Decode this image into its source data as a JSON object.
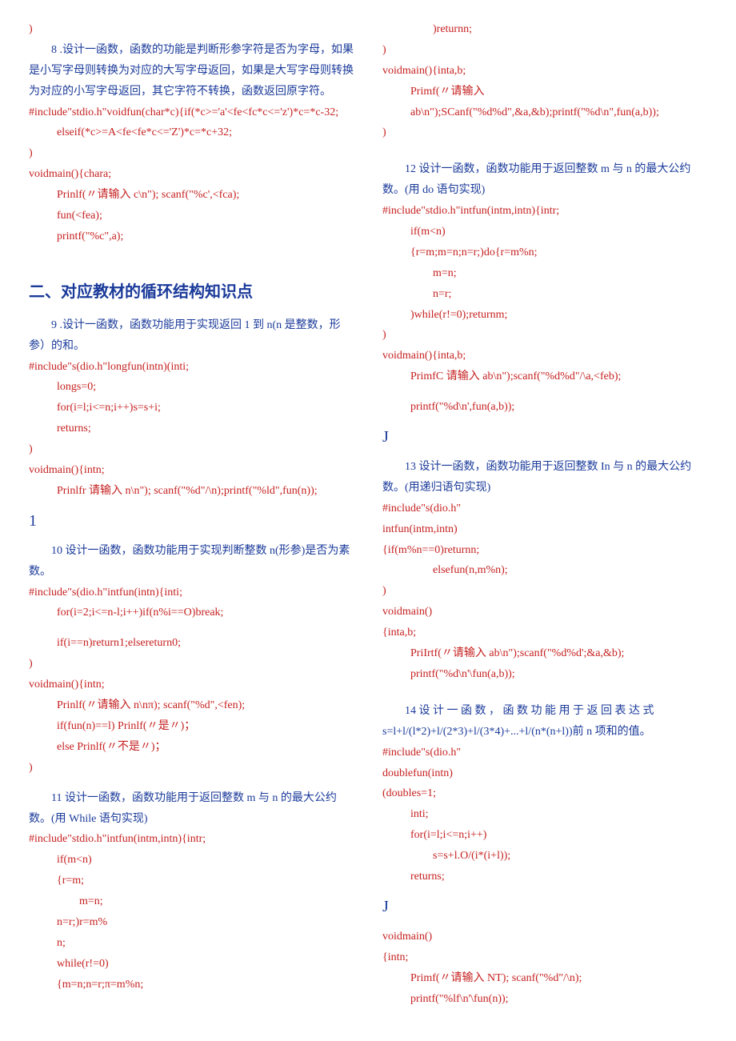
{
  "col1": {
    "l01": ")",
    "l02": "8 .设计一函数，函数的功能是判断形参字符是否为字母，如果是小写字母则转换为对应的大写字母返回，如果是大写字母则转换为对应的小写字母返回，其它字符不转换，函数返回原字符。",
    "l03": "#include\"stdio.h\"voidfun(char*c){if(*c>='a'<fe<fc*c<='z')*c=*c-32;",
    "l04": "elseif(*c>=A<fe<fe*c<='Z')*c=*c+32;",
    "l05": ")",
    "l06": "voidmain(){chara;",
    "l07": "Prinlf(〃请输入 c\\n\");     scanf(\"%c',<fca);",
    "l08": "fun(<fea);",
    "l09": "printf(\"%c\",a);",
    "h2": "二、对应教材的循环结构知识点",
    "l10": "9 .设计一函数，函数功能用于实现返回 1 到 n(n 是整数，形参）的和。",
    "l11": "#include\"s(dio.h\"longfun(intn)(inti;",
    "l12": "longs=0;",
    "l13": "for(i=l;i<=n;i++)s=s+i;",
    "l14": "returns;",
    "l15": ")",
    "l16": "voidmain(){intn;",
    "l17": "Prinlfr 请输入 n\\n\");   scanf(\"%d\"/\\n);printf(\"%ld\",fun(n));",
    "big1": "1",
    "l18": "10 设计一函数，函数功能用于实现判断整数 n(形参)是否为素数。",
    "l19": "#include\"s(dio.h\"intfun(intn){inti;",
    "l20": "for(i=2;i<=n-l;i++)if(n%i==O)break;",
    "l21": "if(i==n)return1;elsereturn0;",
    "l22": ")",
    "l23": "voidmain(){intn;",
    "l24": "Prinlf(〃请输入 n\\nπ);      scanf(\"%d\",<fen);",
    "l25": "if(fun(n)==l)           Prinlf(〃是〃)；",
    "l26": "else        Prinlf(〃不是〃)；",
    "l27": ")",
    "l28": "11 设计一函数，函数功能用于返回整数 m 与 n 的最大公约数。(用 While 语句实现)",
    "l29": "#include\"stdio.h\"intfun(intm,intn){intr;",
    "l30": "if(m<n)",
    "l31": "{r=m;",
    "l32": "m=n;",
    "l33": "n=r;)r=m%",
    "l34": "n;",
    "l35": "while(r!=0)",
    "l36": "{m=n;n=r;π=m%n;"
  },
  "col2": {
    "l01": ")returnn;",
    "l02": ")",
    "l03": "voidmain(){inta,b;",
    "l04": "Primf(〃请输入",
    "l05": "ab\\n\");SCanf(\"%d%d\",&a,&b);printf(\"%d\\n\",fun(a,b));",
    "l06": ")",
    "l07": "12 设计一函数，函数功能用于返回整数 m 与 n 的最大公约数。(用 do 语句实现)",
    "l08": "#include\"stdio.h\"intfun(intm,intn){intr;",
    "l09": "if(m<n)",
    "l10": "{r=m;m=n;n=r;)do{r=m%n;",
    "l11": "m=n;",
    "l12": "n=r;",
    "l13": ")while(r!=0);returnm;",
    "l14": ")",
    "l15": "voidmain(){inta,b;",
    "l16": "PrimfC 请输入 ab\\n\");scanf(\"%d%d\"/\\a,<feb);",
    "l17": "printf(\"%d\\n',fun(a,b));",
    "bigJ1": "J",
    "l18": "13 设计一函数，函数功能用于返回整数 In 与 n 的最大公约数。(用递归语句实现)",
    "l19": "#include\"s(dio.h\"",
    "l20": "intfun(intm,intn)",
    "l21": "{if(m%n==0)returnn;",
    "l22": "elsefun(n,m%n);",
    "l23": ")",
    "l24": "voidmain()",
    "l25": "{inta,b;",
    "l26": "PriIrtf(〃请输入 ab\\n\");scanf(\"%d%d';&a,&b);",
    "l27": "printf(\"%d\\n'\\fun(a,b));",
    "l28": "14 设 计 一 函 数 ， 函 数 功 能 用 于 返 回 表 达 式 s=l+l/(l*2)+l/(2*3)+l/(3*4)+...+l/(n*(n+l))前 n 项和的值。",
    "l29": "#include\"s(dio.h\"",
    "l30": "doublefun(intn)",
    "l31": "(doubles=1;",
    "l32": "inti;",
    "l33": "for(i=l;i<=n;i++)",
    "l34": "s=s+l.O/(i*(i+l));",
    "l35": "returns;",
    "bigJ2": "J",
    "l36": "voidmain()",
    "l37": "{intn;",
    "l38": "Primf(〃请输入 NT);        scanf(\"%d\"/\\n);",
    "l39": "printf(\"%lf\\n'\\fun(n));"
  }
}
